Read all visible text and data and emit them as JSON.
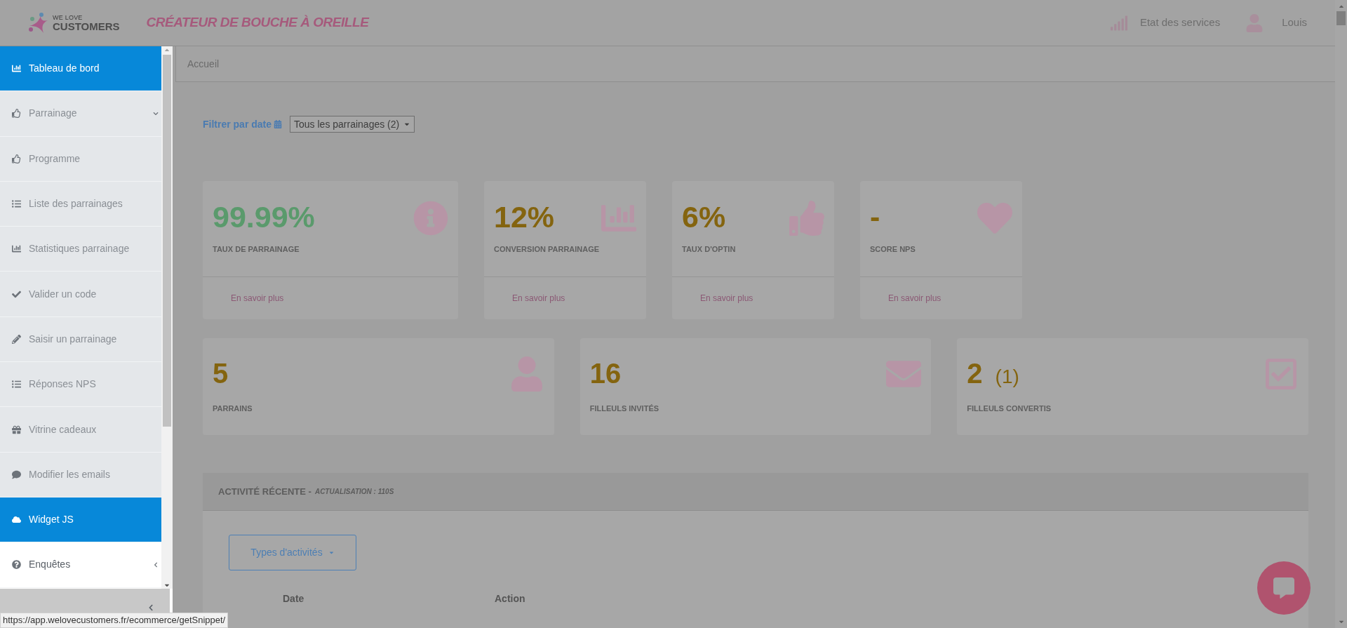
{
  "header": {
    "brand": "WE LOVE",
    "brand_name": "CUSTOMERS",
    "tagline": "CRÉATEUR DE BOUCHE À OREILLE",
    "status_link": "Etat des services",
    "user": "Louis"
  },
  "sidebar": {
    "items": [
      {
        "label": "Tableau de bord",
        "selected": true
      },
      {
        "label": "Parrainage",
        "selected": false,
        "expanded": true,
        "children": [
          {
            "label": "Programme",
            "selected": false
          },
          {
            "label": "Liste des parrainages",
            "selected": false
          },
          {
            "label": "Statistiques parrainage",
            "selected": false
          },
          {
            "label": "Valider un code",
            "selected": false
          },
          {
            "label": "Saisir un parrainage",
            "selected": false
          },
          {
            "label": "Réponses NPS",
            "selected": false
          },
          {
            "label": "Vitrine cadeaux",
            "selected": false
          },
          {
            "label": "Modifier les emails",
            "selected": false
          }
        ]
      },
      {
        "label": "Widget JS",
        "selected": true
      },
      {
        "label": "Enquêtes",
        "selected": false,
        "expanded": false
      }
    ]
  },
  "breadcrumb": "Accueil",
  "filter": {
    "label": "Filtrer par date",
    "value": "Tous les parrainages (2)"
  },
  "kpis": [
    {
      "value": "99.99%",
      "label": "TAUX DE PARRAINAGE",
      "link": "En savoir plus",
      "color": "#5a9a6c"
    },
    {
      "value": "12%",
      "label": "CONVERSION PARRAINAGE",
      "link": "En savoir plus",
      "color": "#84640f"
    },
    {
      "value": "6%",
      "label": "TAUX D'OPTIN",
      "link": "En savoir plus",
      "color": "#84640f"
    },
    {
      "value": "-",
      "label": "SCORE NPS",
      "link": "En savoir plus",
      "color": "#84640f"
    }
  ],
  "counters": [
    {
      "value": "5",
      "label": "PARRAINS",
      "color": "#84640f"
    },
    {
      "value": "16",
      "label": "FILLEULS INVITÉS",
      "color": "#84640f"
    },
    {
      "value": "2",
      "extra": "(1)",
      "label": "FILLEULS CONVERTIS",
      "color": "#84640f"
    }
  ],
  "activity": {
    "title": "ACTIVITÉ RÉCENTE -",
    "subtitle": "ACTUALISATION : 110S",
    "filter_button": "Types d'activités",
    "columns": [
      "Date",
      "Action"
    ]
  },
  "status_url": "https://app.welovecustomers.fr/ecommerce/getSnippet/"
}
